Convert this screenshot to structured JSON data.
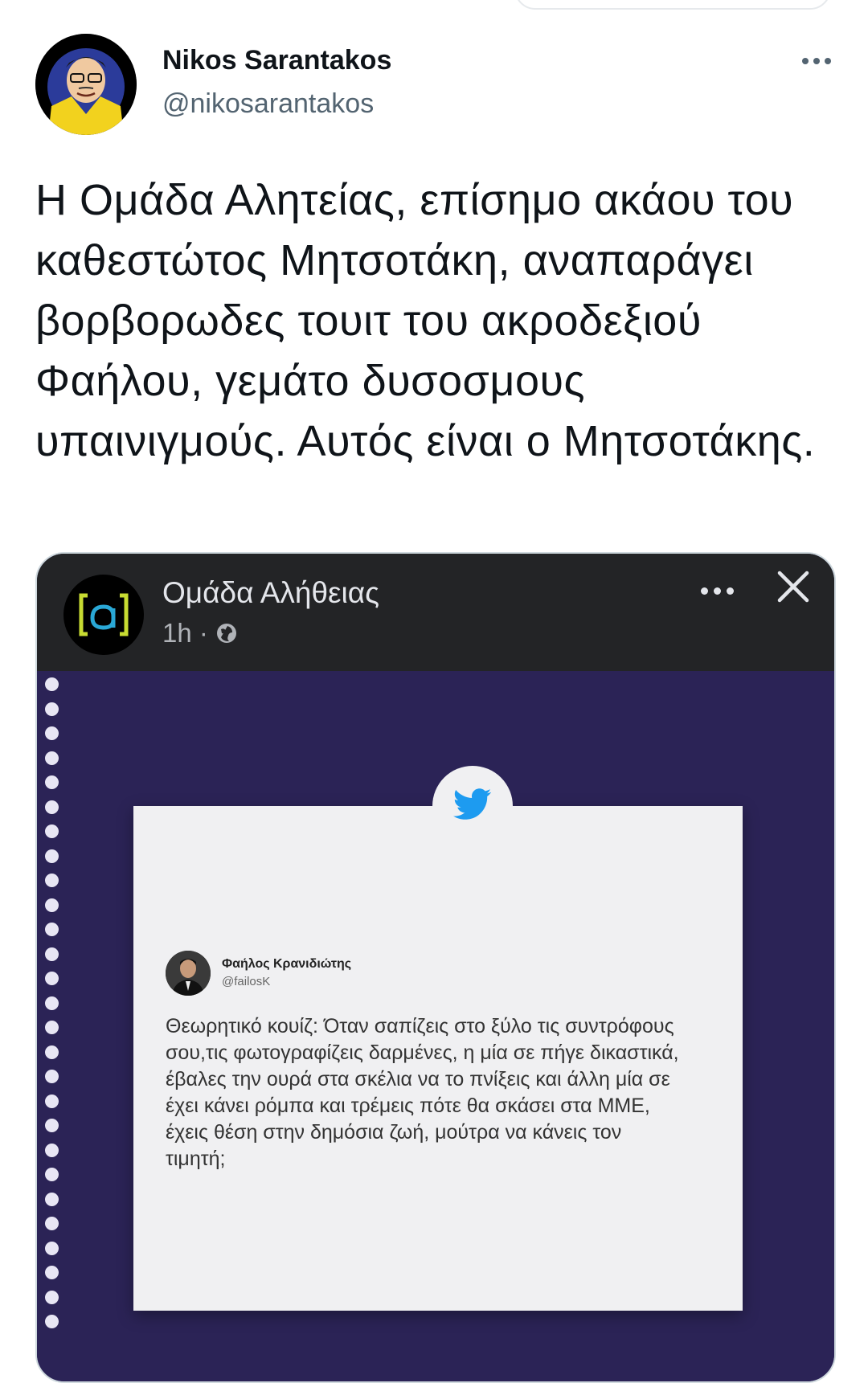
{
  "tweet": {
    "author_name": "Nikos Sarantakos",
    "author_handle": "@nikosarantakos",
    "text": "Η Ομάδα Αλητείας, επίσημο ακάου του καθεστώτος Μητσοτάκη, αναπαράγει βορβορωδες τουιτ του ακροδεξιού Φαήλου, γεμάτο δυσοσμους υπαινιγμούς. Αυτός είναι ο Μητσοτάκης.",
    "more_icon": "more-horizontal-icon"
  },
  "media": {
    "page_name": "Ομάδα Αλήθειας",
    "post_time": "1h ·",
    "privacy_icon": "globe-icon",
    "logo_colors": {
      "bracket": "#c8dc32",
      "letter": "#2aa8d6"
    },
    "embedded_tweet": {
      "author_name": "Φαήλος Κρανιδιώτης",
      "author_handle": "@failosK",
      "text": "Θεωρητικό κουίζ: Όταν σαπίζεις στο ξύλο τις συντρόφους σου,τις φωτογραφίζεις δαρμένες, η μία σε πήγε δικαστικά, έβαλες την ουρά  στα σκέλια να το πνίξεις και άλλη μία σε έχει κάνει ρόμπα και τρέμεις πότε θα σκάσει στα ΜΜΕ, έχεις θέση στην δημόσια ζωή, μούτρα να κάνεις τον τιμητή;"
    }
  },
  "colors": {
    "graphic_background": "#2b2356",
    "twitter_blue": "#1d9bf0"
  }
}
